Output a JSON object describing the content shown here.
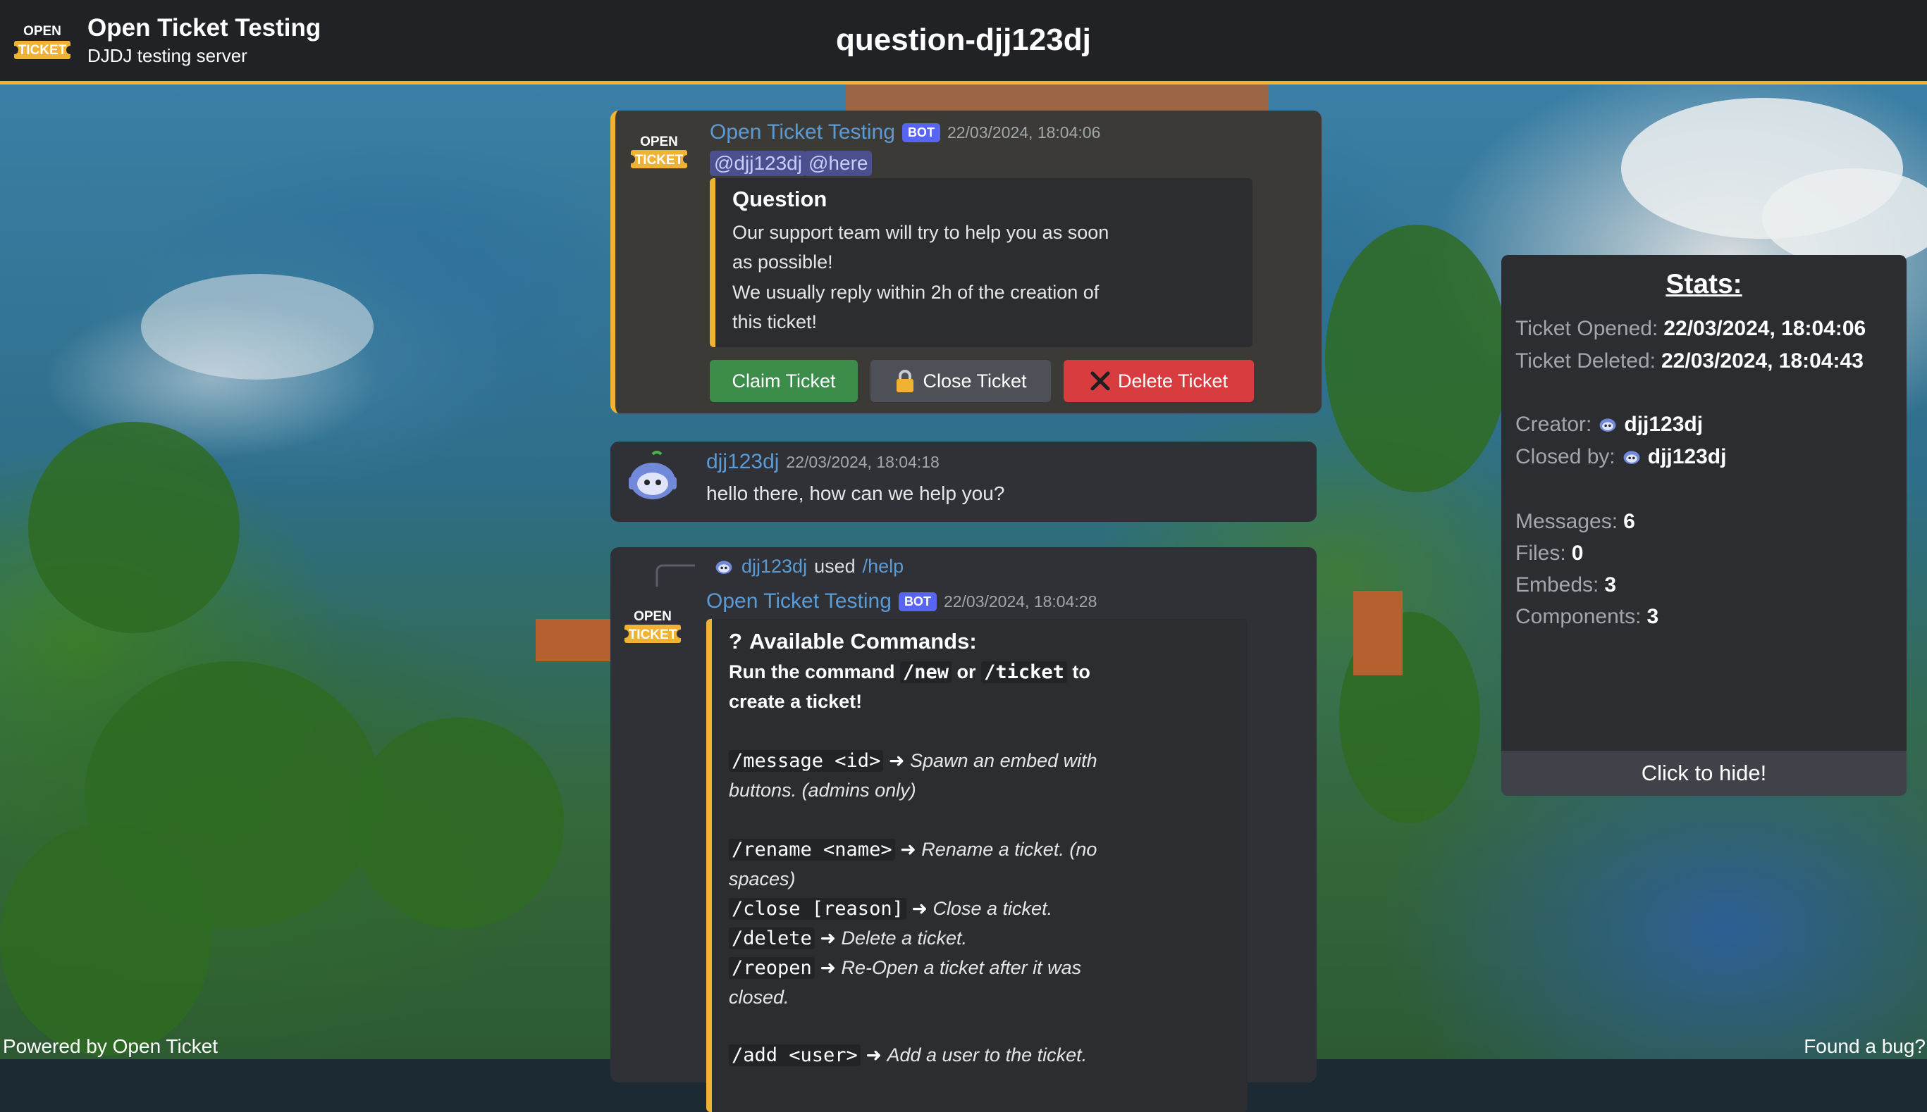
{
  "header": {
    "server_name": "Open Ticket Testing",
    "server_subtitle": "DJDJ testing server",
    "channel_title": "question-djj123dj",
    "logo_text_top": "OPEN",
    "logo_text_bottom": "TICKET"
  },
  "colors": {
    "accent": "#f0b232",
    "bot_badge": "#5865f2",
    "author": "#5b9bd5"
  },
  "messages": [
    {
      "author": "Open Ticket Testing",
      "badge": "BOT",
      "timestamp": "22/03/2024, 18:04:06",
      "mentions": [
        "@djj123dj",
        "@here"
      ],
      "embed": {
        "title": "Question",
        "lines": [
          "Our support team will try to help you as soon",
          "as possible!",
          "We usually reply within 2h of the creation of",
          "this ticket!"
        ]
      },
      "buttons": [
        {
          "label": "Claim Ticket",
          "icon": ""
        },
        {
          "label": "Close Ticket",
          "icon": "lock-icon"
        },
        {
          "label": "Delete Ticket",
          "icon": "x-icon"
        }
      ]
    },
    {
      "author": "djj123dj",
      "timestamp": "22/03/2024, 18:04:18",
      "text": "hello there, how can we help you?"
    },
    {
      "reply": {
        "user": "djj123dj",
        "verb": "used",
        "command": "/help"
      },
      "author": "Open Ticket Testing",
      "badge": "BOT",
      "timestamp": "22/03/2024, 18:04:28",
      "embed": {
        "title": "Available Commands:",
        "title_icon": "?",
        "intro_a": "Run the command ",
        "intro_cmd1": "/new",
        "intro_or": " or ",
        "intro_cmd2": "/ticket",
        "intro_b": " to",
        "intro_line2": "create a ticket!",
        "commands": [
          {
            "cmd": "/message <id>",
            "desc": "Spawn an embed with",
            "desc2": "buttons. (admins only)"
          },
          {
            "cmd": "/rename <name>",
            "desc": "Rename a ticket. (no",
            "desc2": "spaces)"
          },
          {
            "cmd": "/close [reason]",
            "desc": "Close a ticket."
          },
          {
            "cmd": "/delete",
            "desc": "Delete a ticket."
          },
          {
            "cmd": "/reopen",
            "desc": "Re-Open a ticket after it was",
            "desc2": "closed."
          },
          {
            "cmd": "/add <user>",
            "desc": "Add a user to the ticket."
          }
        ]
      }
    }
  ],
  "stats": {
    "title": "Stats:",
    "opened_label": "Ticket Opened:",
    "opened_value": "22/03/2024, 18:04:06",
    "deleted_label": "Ticket Deleted:",
    "deleted_value": "22/03/2024, 18:04:43",
    "creator_label": "Creator:",
    "creator_value": "djj123dj",
    "closed_label": "Closed by:",
    "closed_value": "djj123dj",
    "messages_label": "Messages:",
    "messages_value": "6",
    "files_label": "Files:",
    "files_value": "0",
    "embeds_label": "Embeds:",
    "embeds_value": "3",
    "components_label": "Components:",
    "components_value": "3",
    "hide_label": "Click to hide!"
  },
  "footer": {
    "left": "Powered by Open Ticket",
    "right": "Found a bug?"
  }
}
